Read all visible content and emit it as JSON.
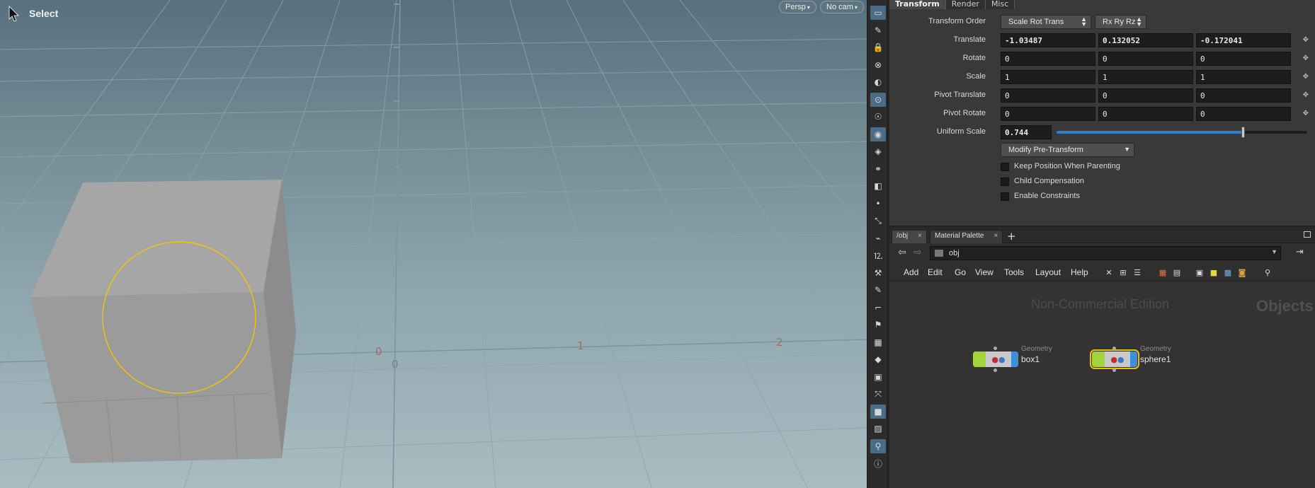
{
  "viewport": {
    "title": "Select",
    "persp_label": "Persp",
    "cam_label": "No cam",
    "grid_labels": [
      "0",
      "1",
      "2",
      "0"
    ]
  },
  "shelf": {
    "icons": [
      "home-icon",
      "view-icon",
      "lock-icon",
      "snap-icon",
      "shading-icon",
      "light-icon",
      "camera-icon",
      "handle-icon",
      "display-icon",
      "visualize-icon",
      "render-icon",
      "point-icon",
      "vector-icon",
      "brush-icon",
      "measure-icon",
      "sculpt-icon",
      "paint-icon",
      "curve-icon",
      "pin-icon",
      "checker-icon",
      "cube-icon",
      "image-icon",
      "bone-icon",
      "square-icon",
      "photo-icon",
      "map-pin-icon",
      "info-icon"
    ]
  },
  "params": {
    "tabs": [
      "Transform",
      "Render",
      "Misc"
    ],
    "transform_order": {
      "label": "Transform Order",
      "value": "Scale Rot Trans",
      "rot_value": "Rx Ry Rz"
    },
    "translate": {
      "label": "Translate",
      "x": "-1.03487",
      "y": "0.132052",
      "z": "-0.172041"
    },
    "rotate": {
      "label": "Rotate",
      "x": "0",
      "y": "0",
      "z": "0"
    },
    "scale": {
      "label": "Scale",
      "x": "1",
      "y": "1",
      "z": "1"
    },
    "pivot_translate": {
      "label": "Pivot Translate",
      "x": "0",
      "y": "0",
      "z": "0"
    },
    "pivot_rotate": {
      "label": "Pivot Rotate",
      "x": "0",
      "y": "0",
      "z": "0"
    },
    "uniform_scale": {
      "label": "Uniform Scale",
      "value": "0.744",
      "slider_fraction": 0.744
    },
    "modify_button": "Modify Pre-Transform",
    "checkboxes": [
      {
        "label": "Keep Position When Parenting",
        "checked": false
      },
      {
        "label": "Child Compensation",
        "checked": false
      },
      {
        "label": "Enable Constraints",
        "checked": false
      }
    ],
    "axis_colors": {
      "x": "#c4372f",
      "y": "#3fa33f",
      "z": "#5b4fc4"
    }
  },
  "network": {
    "tabs": [
      "/obj",
      "Material Palette"
    ],
    "path": "obj",
    "menu": [
      "Add",
      "Edit",
      "Go",
      "View",
      "Tools",
      "Layout",
      "Help"
    ],
    "watermark": "Non-Commercial Edition",
    "context_label": "Objects",
    "nodes": [
      {
        "type": "Geometry",
        "name": "box1",
        "selected": false
      },
      {
        "type": "Geometry",
        "name": "sphere1",
        "selected": true
      }
    ]
  }
}
